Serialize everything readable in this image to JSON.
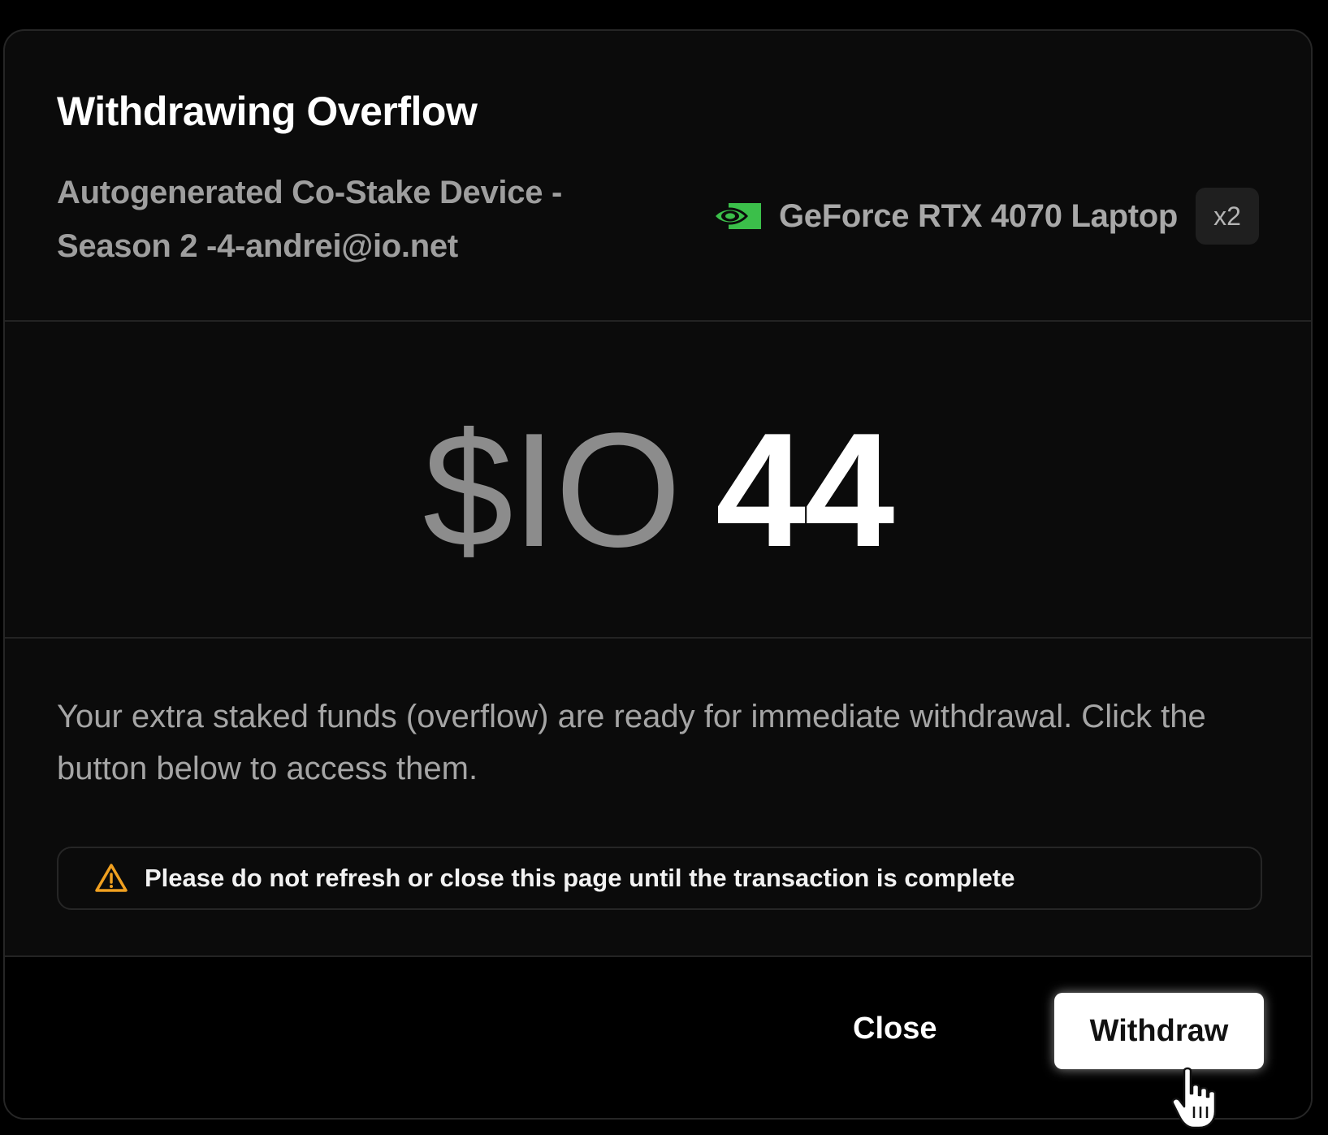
{
  "modal": {
    "title": "Withdrawing Overflow",
    "device_name": "Autogenerated Co-Stake Device - Season 2 -4-andrei@io.net",
    "gpu": {
      "logo_icon": "nvidia-icon",
      "name": "GeForce RTX 4070 Laptop",
      "count": "x2"
    },
    "amount": {
      "currency": "$IO",
      "value": "44"
    },
    "description": "Your extra staked funds (overflow) are ready for immediate withdrawal. Click the button below to access them.",
    "warning": {
      "icon": "warning-triangle-icon",
      "text": "Please do not refresh or close this page until the transaction is complete"
    },
    "footer": {
      "close_label": "Close",
      "withdraw_label": "Withdraw"
    }
  },
  "colors": {
    "background": "#000000",
    "modal_background": "#0b0b0b",
    "border": "#262626",
    "nvidia_green": "#3bbf4a",
    "warning_amber": "#f0a020",
    "muted_text": "#9e9e9e"
  }
}
